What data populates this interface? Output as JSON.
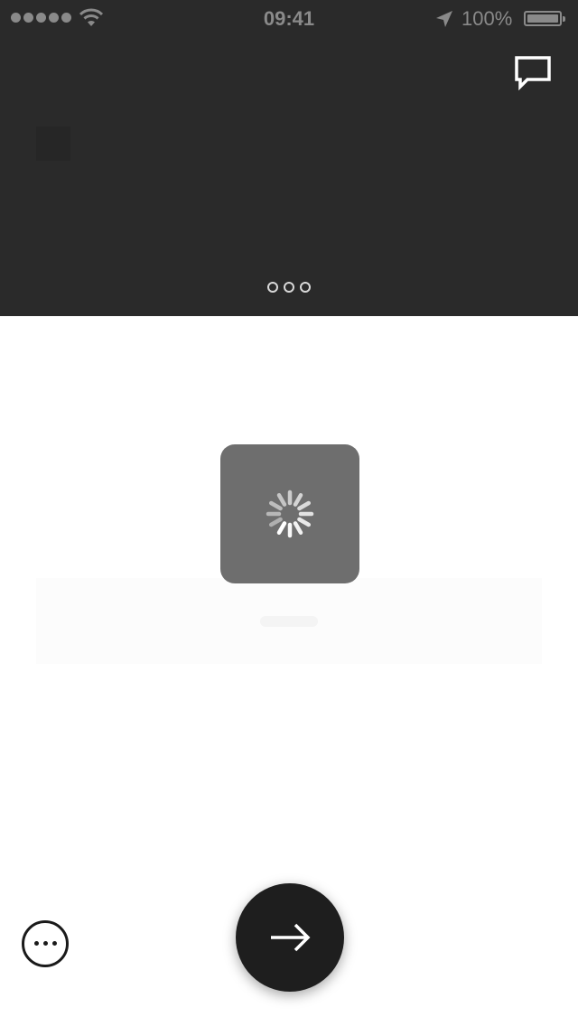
{
  "status_bar": {
    "time": "09:41",
    "battery_percent": "100%",
    "signal_icon": "signal-dots-icon",
    "wifi_icon": "wifi-icon",
    "location_icon": "location-arrow-icon",
    "battery_icon": "battery-icon"
  },
  "header": {
    "chat_icon": "chat-bubble-icon",
    "page_count": 3
  },
  "content": {
    "loading_indicator": "spinner-icon"
  },
  "footer": {
    "more_icon": "ellipsis-circle-icon",
    "next_icon": "arrow-right-icon"
  },
  "colors": {
    "header_background": "#2a2a2a",
    "status_text": "#8a8a8a",
    "loading_box": "#6e6e6e",
    "next_button": "#1e1e1e",
    "page_background": "#ffffff"
  }
}
